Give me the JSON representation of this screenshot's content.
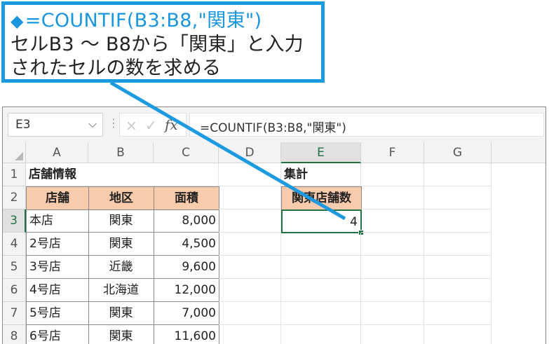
{
  "callout": {
    "diamond": "◆",
    "formula": "=COUNTIF(B3:B8,\"関東\")",
    "line2": "セルB3 ～ B8から「関東」と入力",
    "line3": "されたセルの数を求める"
  },
  "formula_bar": {
    "name_box": "E3",
    "formula": "=COUNTIF(B3:B8,\"関東\")",
    "cancel_icon": "×",
    "enter_icon": "✓",
    "fx_label": "fx",
    "chevron": "⌵",
    "dots": "⋮"
  },
  "columns": [
    "A",
    "B",
    "C",
    "D",
    "E",
    "F",
    "G"
  ],
  "rows": [
    "1",
    "2",
    "3",
    "4",
    "5",
    "6",
    "7",
    "8"
  ],
  "sheet": {
    "a1": "店舗情報",
    "e1": "集計",
    "headers": [
      "店舗",
      "地区",
      "面積"
    ],
    "e2": "関東店舗数",
    "e3": "4",
    "table": [
      [
        "本店",
        "関東",
        "8,000"
      ],
      [
        "2号店",
        "関東",
        "4,500"
      ],
      [
        "3号店",
        "近畿",
        "9,600"
      ],
      [
        "4号店",
        "北海道",
        "12,000"
      ],
      [
        "5号店",
        "関東",
        "7,000"
      ],
      [
        "6号店",
        "関東",
        "11,600"
      ]
    ]
  },
  "colors": {
    "accent": "#1e9be0",
    "header_fill": "#f8cbad",
    "excel_green": "#217346"
  }
}
